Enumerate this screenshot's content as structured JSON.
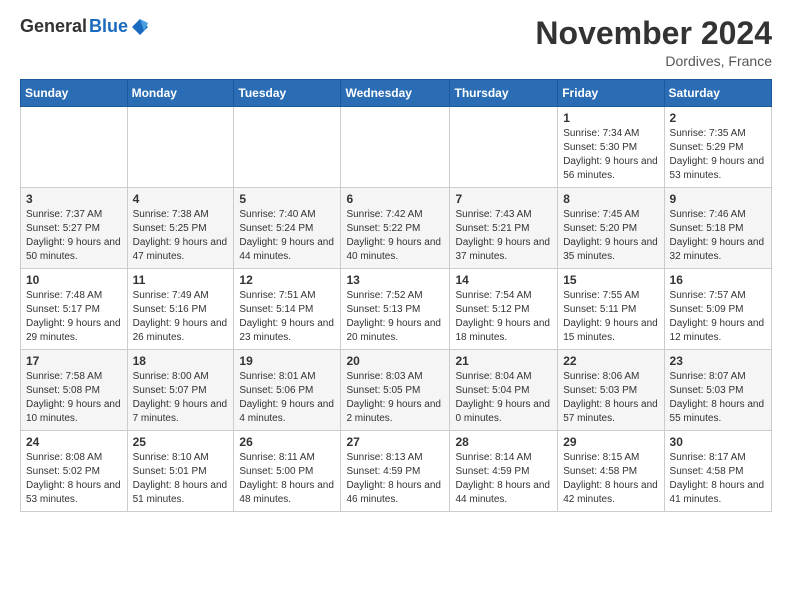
{
  "header": {
    "logo_general": "General",
    "logo_blue": "Blue",
    "month": "November 2024",
    "location": "Dordives, France"
  },
  "weekdays": [
    "Sunday",
    "Monday",
    "Tuesday",
    "Wednesday",
    "Thursday",
    "Friday",
    "Saturday"
  ],
  "weeks": [
    [
      {
        "day": "",
        "info": ""
      },
      {
        "day": "",
        "info": ""
      },
      {
        "day": "",
        "info": ""
      },
      {
        "day": "",
        "info": ""
      },
      {
        "day": "",
        "info": ""
      },
      {
        "day": "1",
        "info": "Sunrise: 7:34 AM\nSunset: 5:30 PM\nDaylight: 9 hours and 56 minutes."
      },
      {
        "day": "2",
        "info": "Sunrise: 7:35 AM\nSunset: 5:29 PM\nDaylight: 9 hours and 53 minutes."
      }
    ],
    [
      {
        "day": "3",
        "info": "Sunrise: 7:37 AM\nSunset: 5:27 PM\nDaylight: 9 hours and 50 minutes."
      },
      {
        "day": "4",
        "info": "Sunrise: 7:38 AM\nSunset: 5:25 PM\nDaylight: 9 hours and 47 minutes."
      },
      {
        "day": "5",
        "info": "Sunrise: 7:40 AM\nSunset: 5:24 PM\nDaylight: 9 hours and 44 minutes."
      },
      {
        "day": "6",
        "info": "Sunrise: 7:42 AM\nSunset: 5:22 PM\nDaylight: 9 hours and 40 minutes."
      },
      {
        "day": "7",
        "info": "Sunrise: 7:43 AM\nSunset: 5:21 PM\nDaylight: 9 hours and 37 minutes."
      },
      {
        "day": "8",
        "info": "Sunrise: 7:45 AM\nSunset: 5:20 PM\nDaylight: 9 hours and 35 minutes."
      },
      {
        "day": "9",
        "info": "Sunrise: 7:46 AM\nSunset: 5:18 PM\nDaylight: 9 hours and 32 minutes."
      }
    ],
    [
      {
        "day": "10",
        "info": "Sunrise: 7:48 AM\nSunset: 5:17 PM\nDaylight: 9 hours and 29 minutes."
      },
      {
        "day": "11",
        "info": "Sunrise: 7:49 AM\nSunset: 5:16 PM\nDaylight: 9 hours and 26 minutes."
      },
      {
        "day": "12",
        "info": "Sunrise: 7:51 AM\nSunset: 5:14 PM\nDaylight: 9 hours and 23 minutes."
      },
      {
        "day": "13",
        "info": "Sunrise: 7:52 AM\nSunset: 5:13 PM\nDaylight: 9 hours and 20 minutes."
      },
      {
        "day": "14",
        "info": "Sunrise: 7:54 AM\nSunset: 5:12 PM\nDaylight: 9 hours and 18 minutes."
      },
      {
        "day": "15",
        "info": "Sunrise: 7:55 AM\nSunset: 5:11 PM\nDaylight: 9 hours and 15 minutes."
      },
      {
        "day": "16",
        "info": "Sunrise: 7:57 AM\nSunset: 5:09 PM\nDaylight: 9 hours and 12 minutes."
      }
    ],
    [
      {
        "day": "17",
        "info": "Sunrise: 7:58 AM\nSunset: 5:08 PM\nDaylight: 9 hours and 10 minutes."
      },
      {
        "day": "18",
        "info": "Sunrise: 8:00 AM\nSunset: 5:07 PM\nDaylight: 9 hours and 7 minutes."
      },
      {
        "day": "19",
        "info": "Sunrise: 8:01 AM\nSunset: 5:06 PM\nDaylight: 9 hours and 4 minutes."
      },
      {
        "day": "20",
        "info": "Sunrise: 8:03 AM\nSunset: 5:05 PM\nDaylight: 9 hours and 2 minutes."
      },
      {
        "day": "21",
        "info": "Sunrise: 8:04 AM\nSunset: 5:04 PM\nDaylight: 9 hours and 0 minutes."
      },
      {
        "day": "22",
        "info": "Sunrise: 8:06 AM\nSunset: 5:03 PM\nDaylight: 8 hours and 57 minutes."
      },
      {
        "day": "23",
        "info": "Sunrise: 8:07 AM\nSunset: 5:03 PM\nDaylight: 8 hours and 55 minutes."
      }
    ],
    [
      {
        "day": "24",
        "info": "Sunrise: 8:08 AM\nSunset: 5:02 PM\nDaylight: 8 hours and 53 minutes."
      },
      {
        "day": "25",
        "info": "Sunrise: 8:10 AM\nSunset: 5:01 PM\nDaylight: 8 hours and 51 minutes."
      },
      {
        "day": "26",
        "info": "Sunrise: 8:11 AM\nSunset: 5:00 PM\nDaylight: 8 hours and 48 minutes."
      },
      {
        "day": "27",
        "info": "Sunrise: 8:13 AM\nSunset: 4:59 PM\nDaylight: 8 hours and 46 minutes."
      },
      {
        "day": "28",
        "info": "Sunrise: 8:14 AM\nSunset: 4:59 PM\nDaylight: 8 hours and 44 minutes."
      },
      {
        "day": "29",
        "info": "Sunrise: 8:15 AM\nSunset: 4:58 PM\nDaylight: 8 hours and 42 minutes."
      },
      {
        "day": "30",
        "info": "Sunrise: 8:17 AM\nSunset: 4:58 PM\nDaylight: 8 hours and 41 minutes."
      }
    ]
  ]
}
